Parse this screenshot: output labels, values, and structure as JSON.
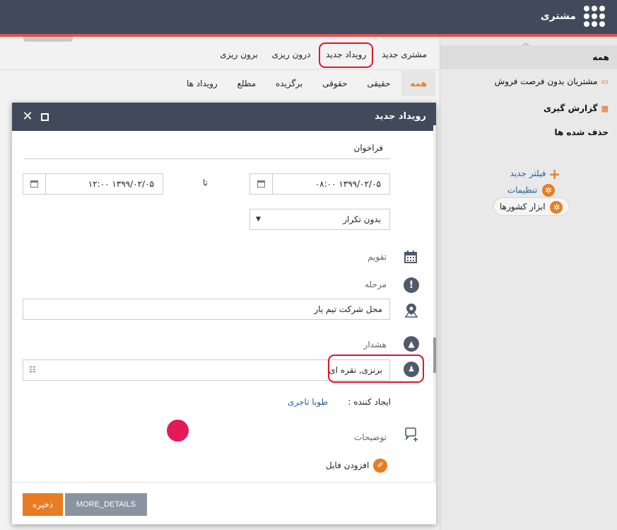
{
  "app": {
    "title": "مشتری"
  },
  "toolbar": {
    "items": [
      "مشتری جدید",
      "رویداد جدید",
      "درون ریزی",
      "برون ریزی"
    ]
  },
  "tabs": [
    "همه",
    "حقیقی",
    "حقوقی",
    "برگزیده",
    "مطلع",
    "رویداد ها"
  ],
  "sidebar": {
    "all_label": "همه",
    "items": [
      "مشتریان بدون فرصت فروش",
      "گزارش گیری",
      "حذف شده ها"
    ],
    "new_filter": "فیلتر جدید",
    "settings": "تنظیمات",
    "countries_tool": "ابزار کشورها"
  },
  "modal": {
    "title": "رویداد جدید",
    "subject_value": "فراخوان",
    "start_datetime": "۱۳۹۹/۰۲/۰۵ ۰۸:۰۰",
    "to_label": "تا",
    "end_datetime": "۱۳۹۹/۰۲/۰۵ ۱۲:۰۰",
    "repeat_value": "بدون تکرار",
    "calendar_label": "تقویم",
    "stage_label": "مرحله",
    "location_value": "محل شرکت تیم یار",
    "alert_label": "هشدار",
    "participants_value": "برنزی, نقره ای",
    "creator_label": "ایجاد کننده :",
    "creator_name": "طوبا تاجری",
    "description_label": "توضیحات",
    "add_file_label": "افزودن فایل",
    "save_label": "ذخیره",
    "more_details_label": "MORE_DETAILS"
  },
  "colors": {
    "header_bg": "#404a5a",
    "accent_orange": "#e67e22",
    "highlight_red": "#e0162b",
    "avatar": "#e4195a",
    "link_blue": "#1f5fa0"
  }
}
